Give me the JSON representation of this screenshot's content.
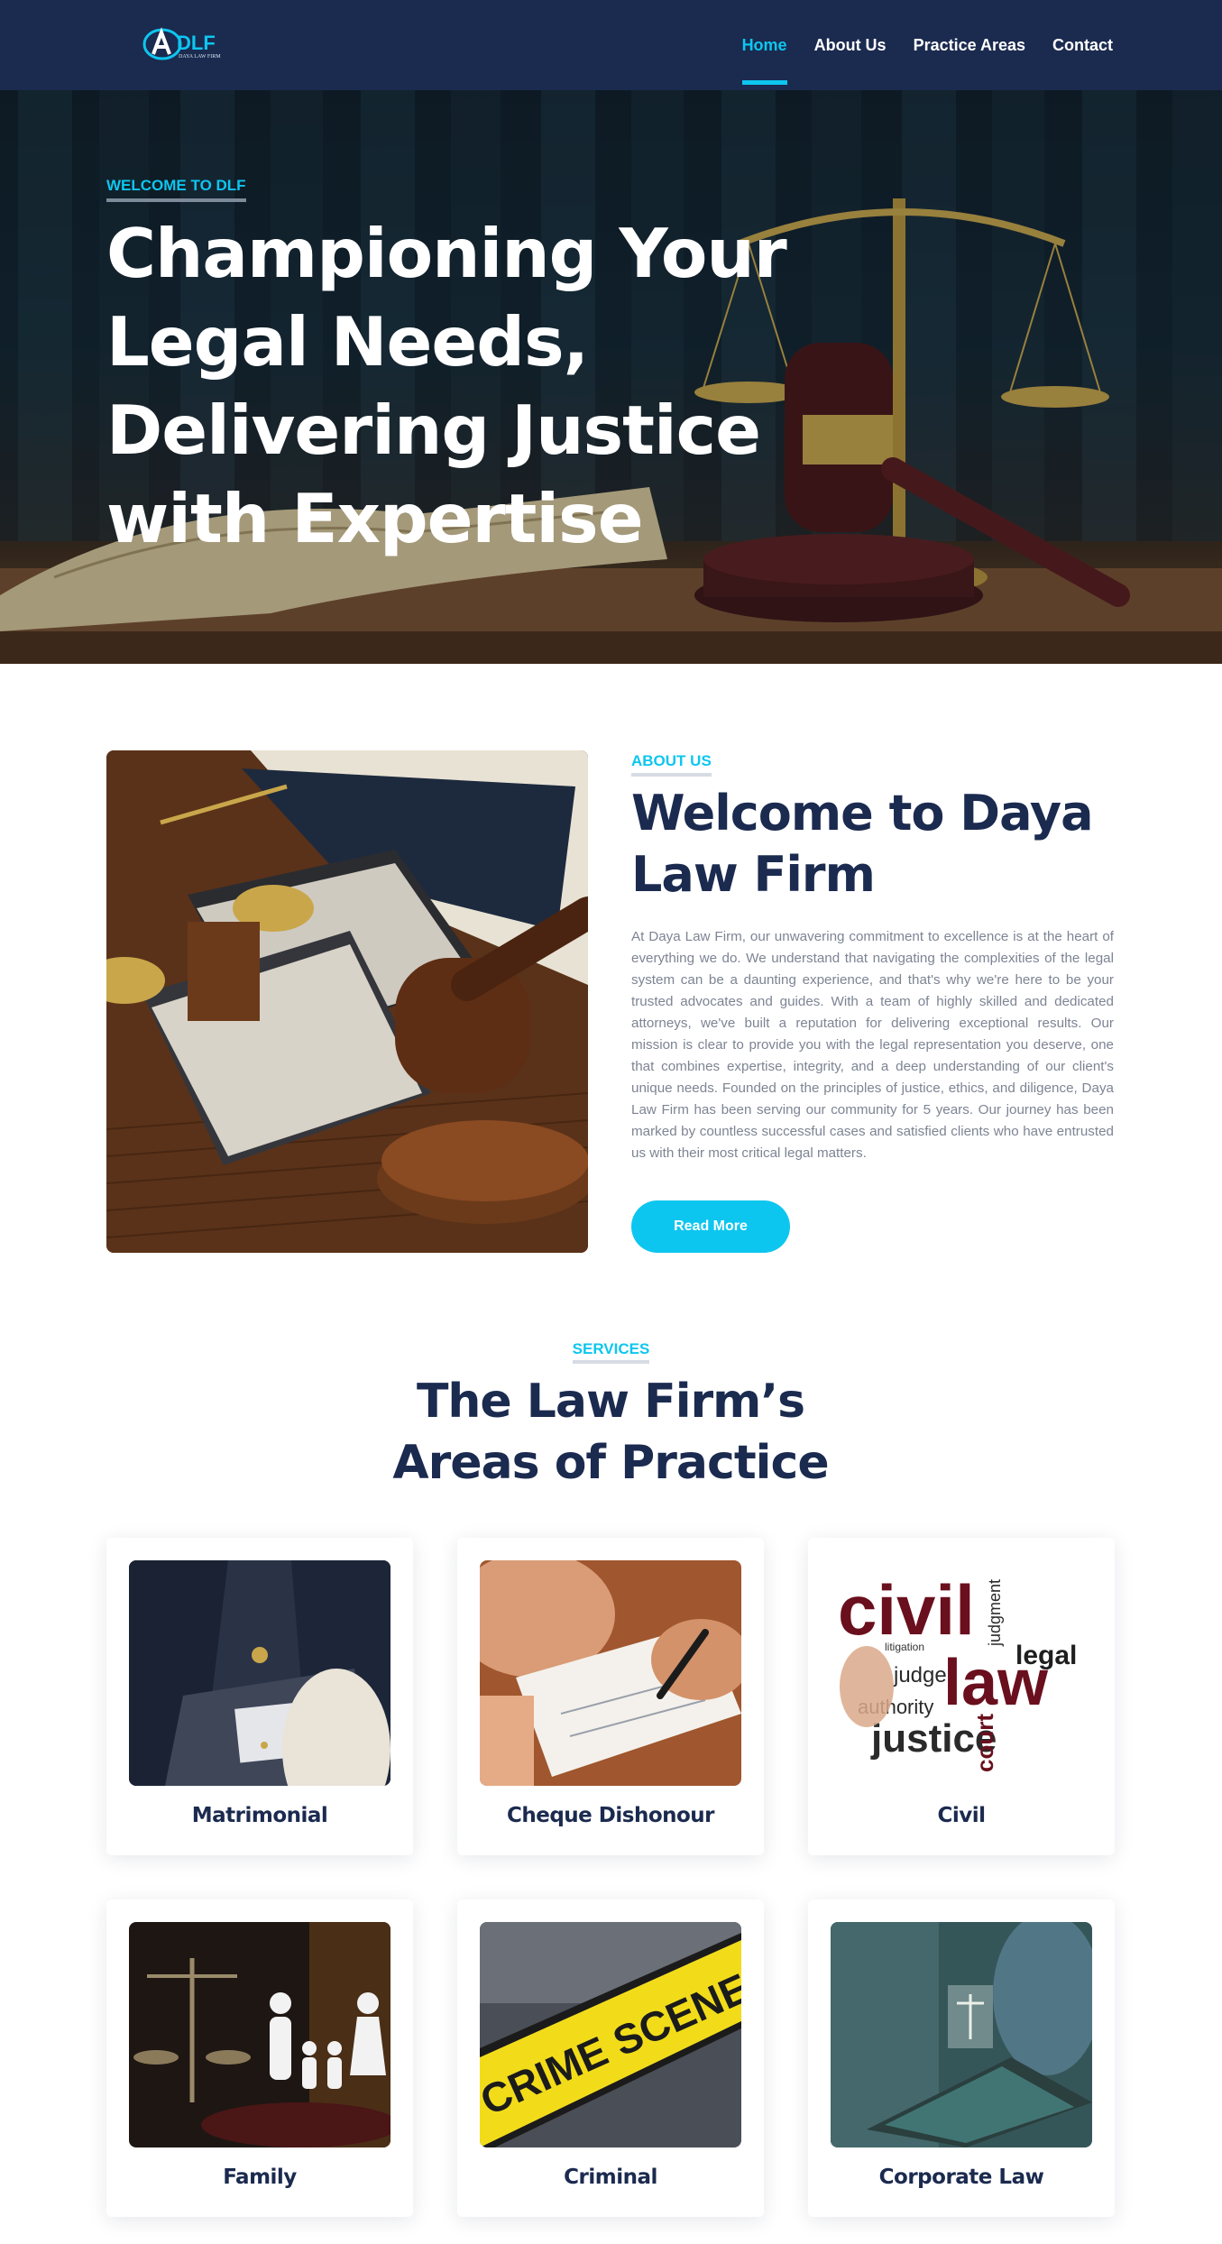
{
  "nav": {
    "logo_text": "DLF",
    "logo_tagline": "DAYA LAW FIRM",
    "items": [
      {
        "label": "Home",
        "active": true
      },
      {
        "label": "About Us",
        "active": false
      },
      {
        "label": "Practice Areas",
        "active": false
      },
      {
        "label": "Contact",
        "active": false
      }
    ]
  },
  "hero": {
    "kicker": "WELCOME TO DLF",
    "title": "Championing Your Legal Needs, Delivering Justice with Expertise"
  },
  "about": {
    "kicker": "ABOUT US",
    "title": "Welcome to Daya Law Firm",
    "body": "At Daya Law Firm, our unwavering commitment to excellence is at the heart of everything we do. We understand that navigating the complexities of the legal system can be a daunting experience, and that's why we're here to be your trusted advocates and guides. With a team of highly skilled and dedicated attorneys, we've built a reputation for delivering exceptional results. Our mission is clear to provide you with the legal representation you deserve, one that combines expertise, integrity, and a deep understanding of our client's unique needs. Founded on the principles of justice, ethics, and diligence, Daya Law Firm has been serving our community for 5 years. Our journey has been marked by countless successful cases and satisfied clients who have entrusted us with their most critical legal matters.",
    "button": "Read More"
  },
  "services": {
    "kicker": "SERVICES",
    "title": "The Law Firm’s Areas of Practice",
    "cards": [
      {
        "label": "Matrimonial",
        "image": "matrimonial-photo"
      },
      {
        "label": "Cheque Dishonour",
        "image": "cheque-photo"
      },
      {
        "label": "Civil",
        "image": "civil-law-wordcloud"
      },
      {
        "label": "Family",
        "image": "family-photo"
      },
      {
        "label": "Criminal",
        "image": "crime-scene-tape-photo"
      },
      {
        "label": "Corporate Law",
        "image": "corporate-law-photo"
      }
    ],
    "civil_words": [
      "civil",
      "law",
      "legal",
      "justice",
      "judge",
      "authority",
      "court",
      "judgment",
      "litigation"
    ],
    "crime_tape_text": "CRIME SCENE DO NOT CROSS"
  },
  "colors": {
    "navy": "#1b2a4f",
    "accent": "#0dc6ef",
    "text_muted": "#7d8493"
  }
}
